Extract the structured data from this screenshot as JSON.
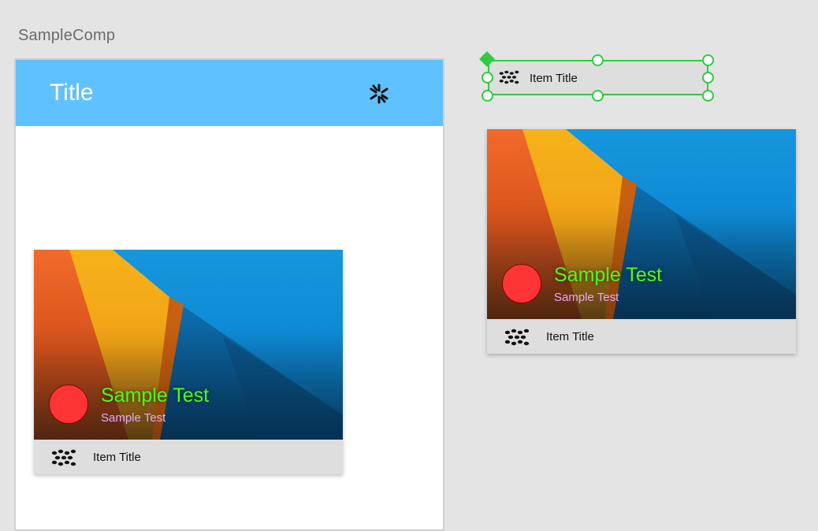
{
  "canvas": {
    "component_name": "SampleComp"
  },
  "artboard": {
    "appbar": {
      "title": "Title",
      "action_icon": "asterisk-burst-icon",
      "color": "#5fc1ff"
    }
  },
  "cards": [
    {
      "title": "Sample Test",
      "subtitle": "Sample Test",
      "avatar_color": "#ff3434",
      "list_item": {
        "label": "Item Title",
        "icon": "dots-cluster-icon"
      }
    },
    {
      "title": "Sample Test",
      "subtitle": "Sample Test",
      "avatar_color": "#ff3434",
      "list_item": {
        "label": "Item Title",
        "icon": "dots-cluster-icon"
      }
    }
  ],
  "selected_component": {
    "label": "Item Title",
    "icon": "dots-cluster-icon",
    "selection_color": "#2ecc40"
  },
  "colors": {
    "title_green": "#4cff14",
    "subtitle_pink": "#e8a8ff",
    "canvas_bg": "#e4e4e4"
  }
}
